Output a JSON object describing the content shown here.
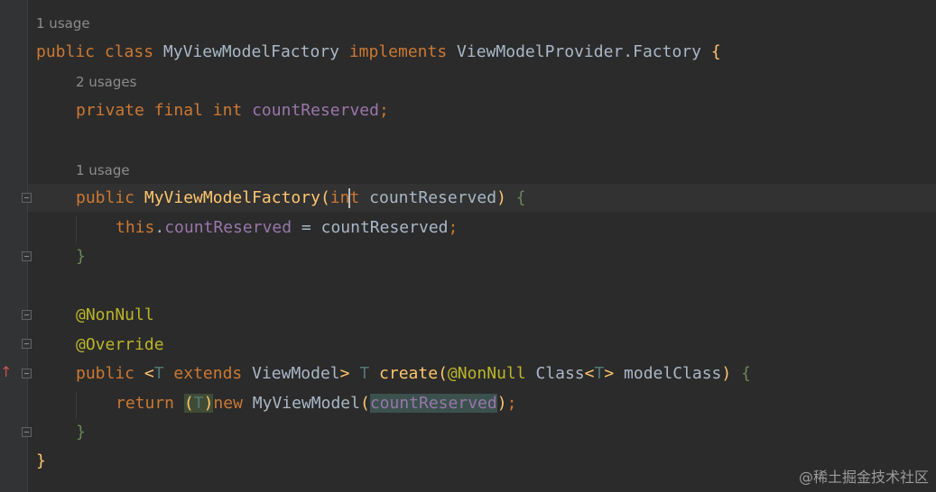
{
  "hints": {
    "class_usage": "1 usage",
    "field_usages": "2 usages",
    "constructor_usage": "1 usage"
  },
  "code": {
    "kw_public": "public",
    "kw_class": "class",
    "kw_implements": "implements",
    "kw_private": "private",
    "kw_final": "final",
    "kw_int": "int",
    "kw_this": "this",
    "kw_extends": "extends",
    "kw_return": "return",
    "kw_new": "new",
    "class_name": "MyViewModelFactory",
    "interface_name": "ViewModelProvider.Factory",
    "field_name": "countReserved",
    "param_name": "countReserved",
    "annotation_nonnull": "@NonNull",
    "annotation_override": "@Override",
    "type_param": "T",
    "viewmodel_type": "ViewModel",
    "method_name": "create",
    "class_type": "Class",
    "model_param": "modelClass",
    "viewmodel_impl": "MyViewModel"
  },
  "watermark": "@稀土掘金技术社区",
  "colors": {
    "background": "#2b2b2b",
    "keyword": "#cc7832",
    "function": "#ffc66d",
    "field": "#9876aa",
    "annotation": "#bbb529",
    "plain": "#a9b7c6"
  }
}
